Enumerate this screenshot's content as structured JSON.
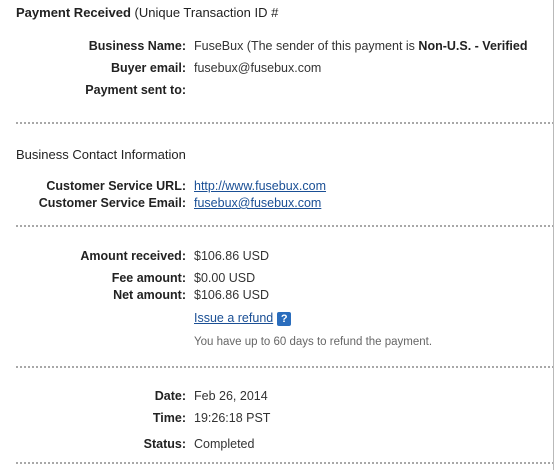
{
  "header": {
    "title_bold": "Payment Received",
    "title_rest": " (Unique Transaction ID #"
  },
  "payer": {
    "business_name_label": "Business Name:",
    "business_name_value": "FuseBux (The sender of this payment is ",
    "business_name_status": "Non-U.S. - Verified",
    "buyer_email_label": "Buyer email:",
    "buyer_email_value": "fusebux@fusebux.com",
    "payment_sent_to_label": "Payment sent to:",
    "payment_sent_to_value": ""
  },
  "contact": {
    "heading": "Business Contact Information",
    "url_label": "Customer Service URL:",
    "url_value": "http://www.fusebux.com",
    "email_label": "Customer Service Email:",
    "email_value": "fusebux@fusebux.com"
  },
  "amounts": {
    "received_label": "Amount received:",
    "received_value": "$106.86 USD",
    "fee_label": "Fee amount:",
    "fee_value": "$0.00 USD",
    "net_label": "Net amount:",
    "net_value": "$106.86 USD",
    "refund_link": "Issue a refund",
    "help_icon": "?",
    "refund_note": "You have up to 60 days to refund the payment."
  },
  "details": {
    "date_label": "Date:",
    "date_value": "Feb 26, 2014",
    "time_label": "Time:",
    "time_value": "19:26:18 PST",
    "status_label": "Status:",
    "status_value": "Completed"
  },
  "colors": {
    "link": "#1a4f95",
    "help_icon_bg": "#2a6dbd",
    "separator": "#a8a8a8"
  }
}
